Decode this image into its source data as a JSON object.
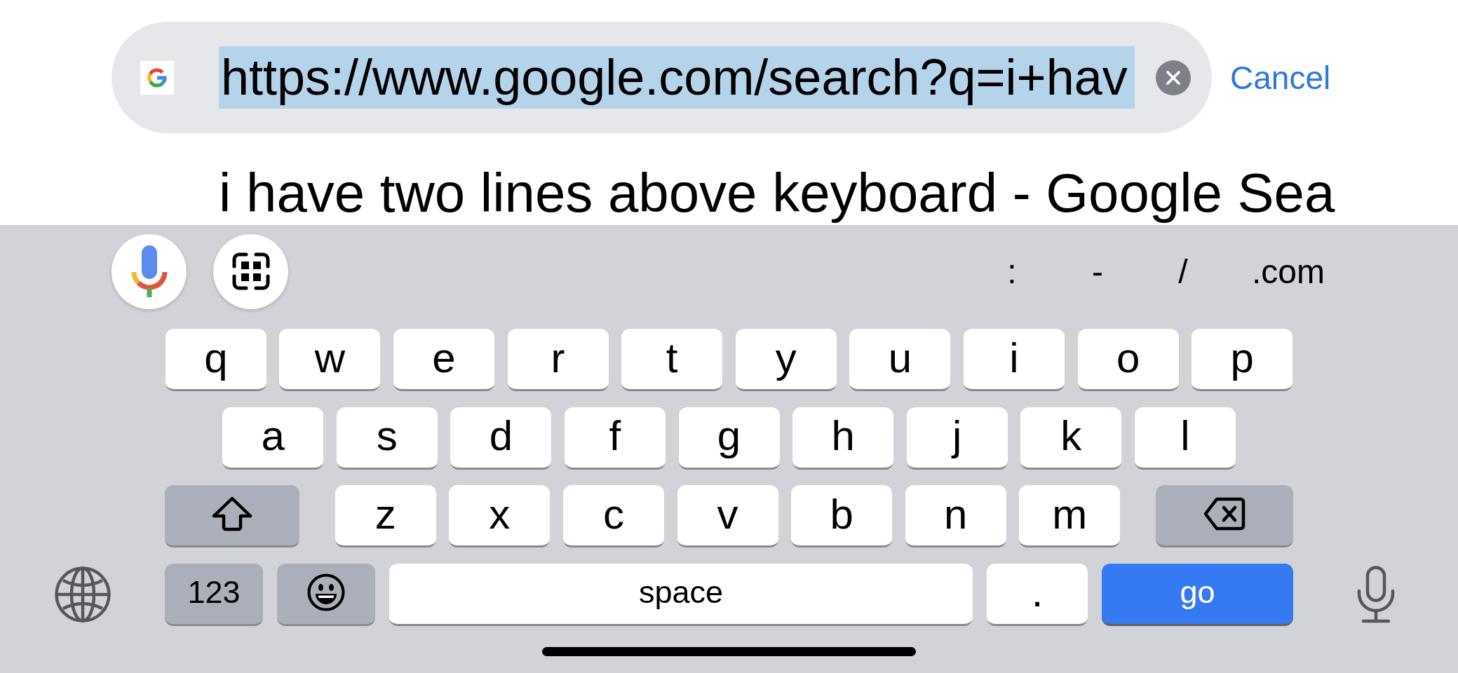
{
  "address_bar": {
    "url": "https://www.google.com/search?q=i+hav",
    "url_selected": true,
    "cancel": "Cancel"
  },
  "suggestion": {
    "title": "i have two lines above keyboard - Google Sea"
  },
  "keyboard": {
    "shortcuts": [
      ":",
      "-",
      "/",
      ".com"
    ],
    "rows": [
      {
        "keys": [
          {
            "kind": "letter",
            "label": "q"
          },
          {
            "kind": "letter",
            "label": "w"
          },
          {
            "kind": "letter",
            "label": "e"
          },
          {
            "kind": "letter",
            "label": "r"
          },
          {
            "kind": "letter",
            "label": "t"
          },
          {
            "kind": "letter",
            "label": "y"
          },
          {
            "kind": "letter",
            "label": "u"
          },
          {
            "kind": "letter",
            "label": "i"
          },
          {
            "kind": "letter",
            "label": "o"
          },
          {
            "kind": "letter",
            "label": "p"
          }
        ]
      },
      {
        "keys": [
          {
            "kind": "letter",
            "label": "a"
          },
          {
            "kind": "letter",
            "label": "s"
          },
          {
            "kind": "letter",
            "label": "d"
          },
          {
            "kind": "letter",
            "label": "f"
          },
          {
            "kind": "letter",
            "label": "g"
          },
          {
            "kind": "letter",
            "label": "h"
          },
          {
            "kind": "letter",
            "label": "j"
          },
          {
            "kind": "letter",
            "label": "k"
          },
          {
            "kind": "letter",
            "label": "l"
          }
        ]
      },
      {
        "keys": [
          {
            "kind": "shift",
            "on": false
          },
          {
            "kind": "letter",
            "label": "z"
          },
          {
            "kind": "letter",
            "label": "x"
          },
          {
            "kind": "letter",
            "label": "c"
          },
          {
            "kind": "letter",
            "label": "v"
          },
          {
            "kind": "letter",
            "label": "b"
          },
          {
            "kind": "letter",
            "label": "n"
          },
          {
            "kind": "letter",
            "label": "m"
          },
          {
            "kind": "delete"
          }
        ]
      },
      {
        "keys": [
          {
            "kind": "mode",
            "label": "123"
          },
          {
            "kind": "emoji"
          },
          {
            "kind": "space",
            "label": "space"
          },
          {
            "kind": "letter",
            "label": "."
          },
          {
            "kind": "go",
            "label": "go"
          }
        ]
      }
    ]
  }
}
